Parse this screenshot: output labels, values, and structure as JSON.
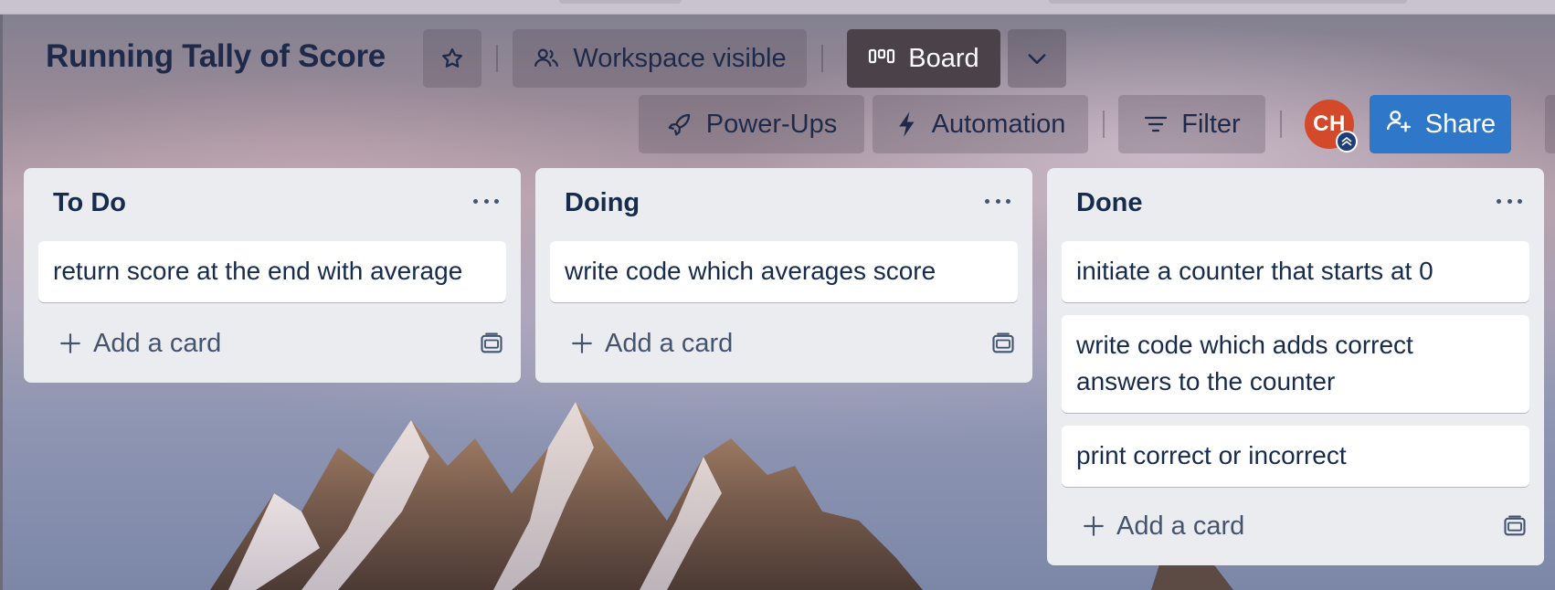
{
  "board": {
    "title": "Running Tally of Score",
    "visibility_label": "Workspace visible",
    "view_label": "Board",
    "powerups_label": "Power-Ups",
    "automation_label": "Automation",
    "filter_label": "Filter",
    "share_label": "Share",
    "member_initials": "CH"
  },
  "lists": [
    {
      "title": "To Do",
      "cards": [
        "return score at the end with average"
      ],
      "add_label": "Add a card"
    },
    {
      "title": "Doing",
      "cards": [
        "write code which averages score"
      ],
      "add_label": "Add a card"
    },
    {
      "title": "Done",
      "cards": [
        "initiate a counter that starts at 0",
        "write code which adds correct answers to the counter",
        "print correct or incorrect"
      ],
      "add_label": "Add a card"
    }
  ],
  "colors": {
    "share_blue": "#2f77c8",
    "board_button": "#4a4149",
    "avatar": "#d4492a",
    "list_bg": "#ebecf0",
    "text": "#172b4d"
  },
  "icons": [
    "star-icon",
    "workspace-icon",
    "board-view-icon",
    "chevron-down-icon",
    "rocket-icon",
    "bolt-icon",
    "filter-icon",
    "add-member-icon",
    "plus-icon",
    "template-icon",
    "more-icon"
  ]
}
